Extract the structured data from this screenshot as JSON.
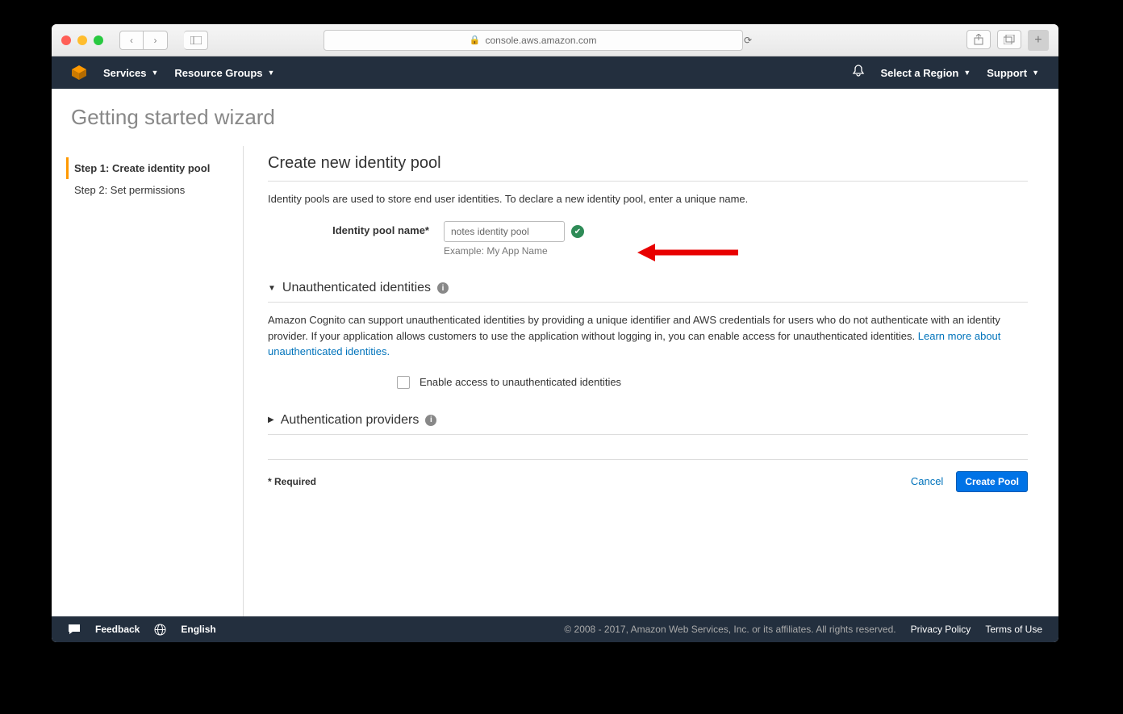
{
  "browser": {
    "url": "console.aws.amazon.com"
  },
  "topnav": {
    "services": "Services",
    "resource_groups": "Resource Groups",
    "region": "Select a Region",
    "support": "Support"
  },
  "page_title": "Getting started wizard",
  "steps": [
    {
      "label": "Step 1: Create identity pool"
    },
    {
      "label": "Step 2: Set permissions"
    }
  ],
  "main": {
    "heading": "Create new identity pool",
    "intro": "Identity pools are used to store end user identities. To declare a new identity pool, enter a unique name.",
    "pool_name_label": "Identity pool name*",
    "pool_name_value": "notes identity pool",
    "pool_name_example": "Example: My App Name",
    "unauth": {
      "title": "Unauthenticated identities",
      "body_text": "Amazon Cognito can support unauthenticated identities by providing a unique identifier and AWS credentials for users who do not authenticate with an identity provider. If your application allows customers to use the application without logging in, you can enable access for unauthenticated identities. ",
      "link_text": "Learn more about unauthenticated identities.",
      "checkbox_label": "Enable access to unauthenticated identities"
    },
    "authp": {
      "title": "Authentication providers"
    },
    "required_note": "* Required",
    "cancel": "Cancel",
    "create": "Create Pool"
  },
  "footer": {
    "feedback": "Feedback",
    "language": "English",
    "copyright": "© 2008 - 2017, Amazon Web Services, Inc. or its affiliates. All rights reserved.",
    "privacy": "Privacy Policy",
    "terms": "Terms of Use"
  }
}
